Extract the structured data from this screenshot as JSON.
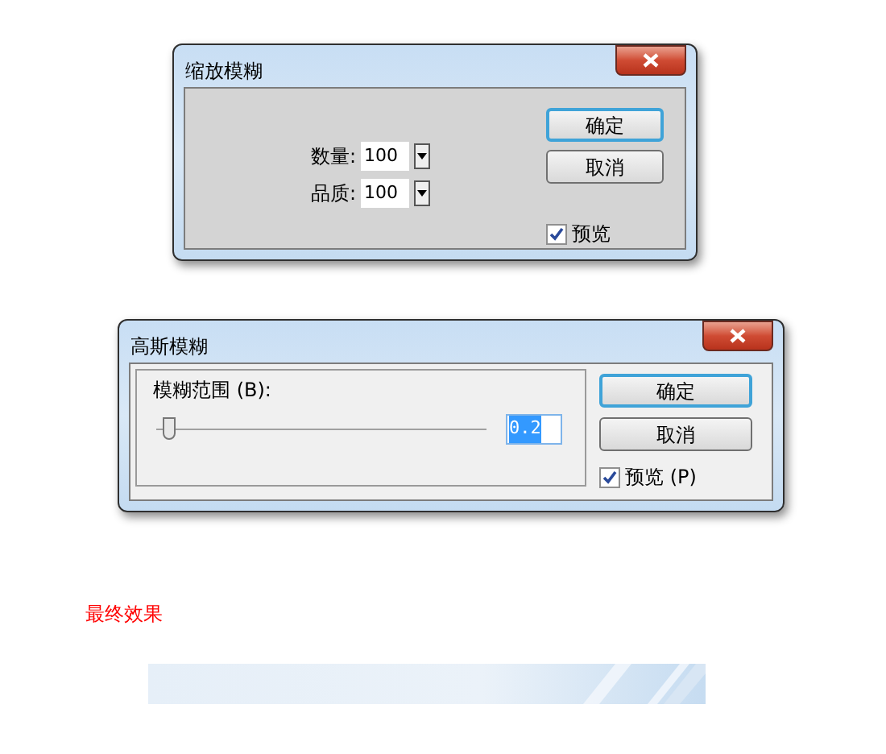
{
  "dialogs": [
    {
      "kind": "fields",
      "title": "缩放模糊",
      "fields": [
        {
          "label": "数量:",
          "value": "100"
        },
        {
          "label": "品质:",
          "value": "100"
        }
      ],
      "buttons": [
        {
          "label": "确定",
          "default": true
        },
        {
          "label": "取消",
          "default": false
        }
      ],
      "preview": {
        "label": "预览",
        "checked": true
      }
    },
    {
      "kind": "slider",
      "title": "高斯模糊",
      "slider": {
        "label": "模糊范围 (B):",
        "level": 0.02,
        "value": "0.2"
      },
      "buttons": [
        {
          "label": "确定",
          "default": true
        },
        {
          "label": "取消",
          "default": false
        }
      ],
      "preview": {
        "label": "预览 (P)",
        "checked": true
      }
    }
  ],
  "caption": "最终效果"
}
